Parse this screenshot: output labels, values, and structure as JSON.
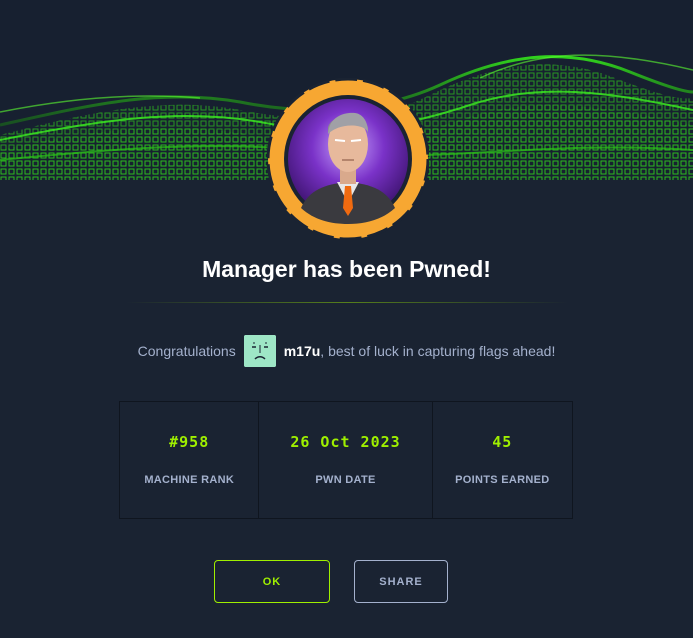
{
  "title": "Manager has been Pwned!",
  "congrats": {
    "prefix": "Congratulations",
    "username": "m17u",
    "suffix": ", best of luck in capturing flags ahead!"
  },
  "stats": [
    {
      "value": "#958",
      "label": "MACHINE RANK"
    },
    {
      "value": "26 Oct 2023",
      "label": "PWN DATE"
    },
    {
      "value": "45",
      "label": "POINTS EARNED"
    }
  ],
  "buttons": {
    "ok": "OK",
    "share": "SHARE"
  },
  "colors": {
    "accent": "#9fef00",
    "background": "#1a2332",
    "ring": "#f7a732",
    "muted": "#a4b1cd"
  }
}
